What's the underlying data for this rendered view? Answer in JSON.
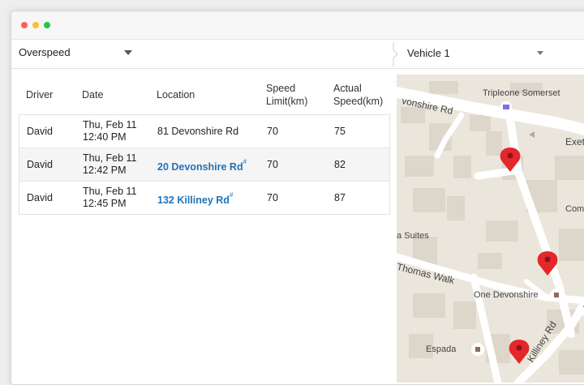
{
  "toolbar": {
    "type_select": {
      "value": "Overspeed"
    },
    "vehicle_select": {
      "value": "Vehicle 1"
    }
  },
  "table": {
    "headers": {
      "driver": "Driver",
      "date": "Date",
      "location": "Location",
      "speed_limit_1": "Speed",
      "speed_limit_2": "Limit(km)",
      "actual_1": "Actual",
      "actual_2": "Speed(km)"
    },
    "rows": [
      {
        "driver": "David",
        "date_line1": "Thu, Feb 11",
        "date_line2": "12:40 PM",
        "location": "81 Devonshire Rd",
        "location_mark": "",
        "speed_limit": "70",
        "actual_speed": "75"
      },
      {
        "driver": "David",
        "date_line1": "Thu, Feb 11",
        "date_line2": "12:42 PM",
        "location": "20 Devonshire Rd",
        "location_mark": "#",
        "speed_limit": "70",
        "actual_speed": "82"
      },
      {
        "driver": "David",
        "date_line1": "Thu, Feb 11",
        "date_line2": "12:45 PM",
        "location": "132 Killiney Rd",
        "location_mark": "#",
        "speed_limit": "70",
        "actual_speed": "87"
      }
    ]
  },
  "map": {
    "labels": {
      "poi_tripleone": "Tripleone Somerset",
      "road_devonshire": "vonshire Rd",
      "road_exet": "Exet",
      "poi_comcen": "Comcen",
      "poi_suites": "a Suites",
      "road_thomas": "Thomas Walk",
      "poi_one_devonshire": "One Devonshire",
      "poi_espada": "Espada",
      "road_killiney": "Killiney Rd"
    },
    "colors": {
      "background": "#ebe6dc",
      "road": "#ffffff",
      "building": "#dcd6cb",
      "marker": "#e4272a"
    }
  }
}
